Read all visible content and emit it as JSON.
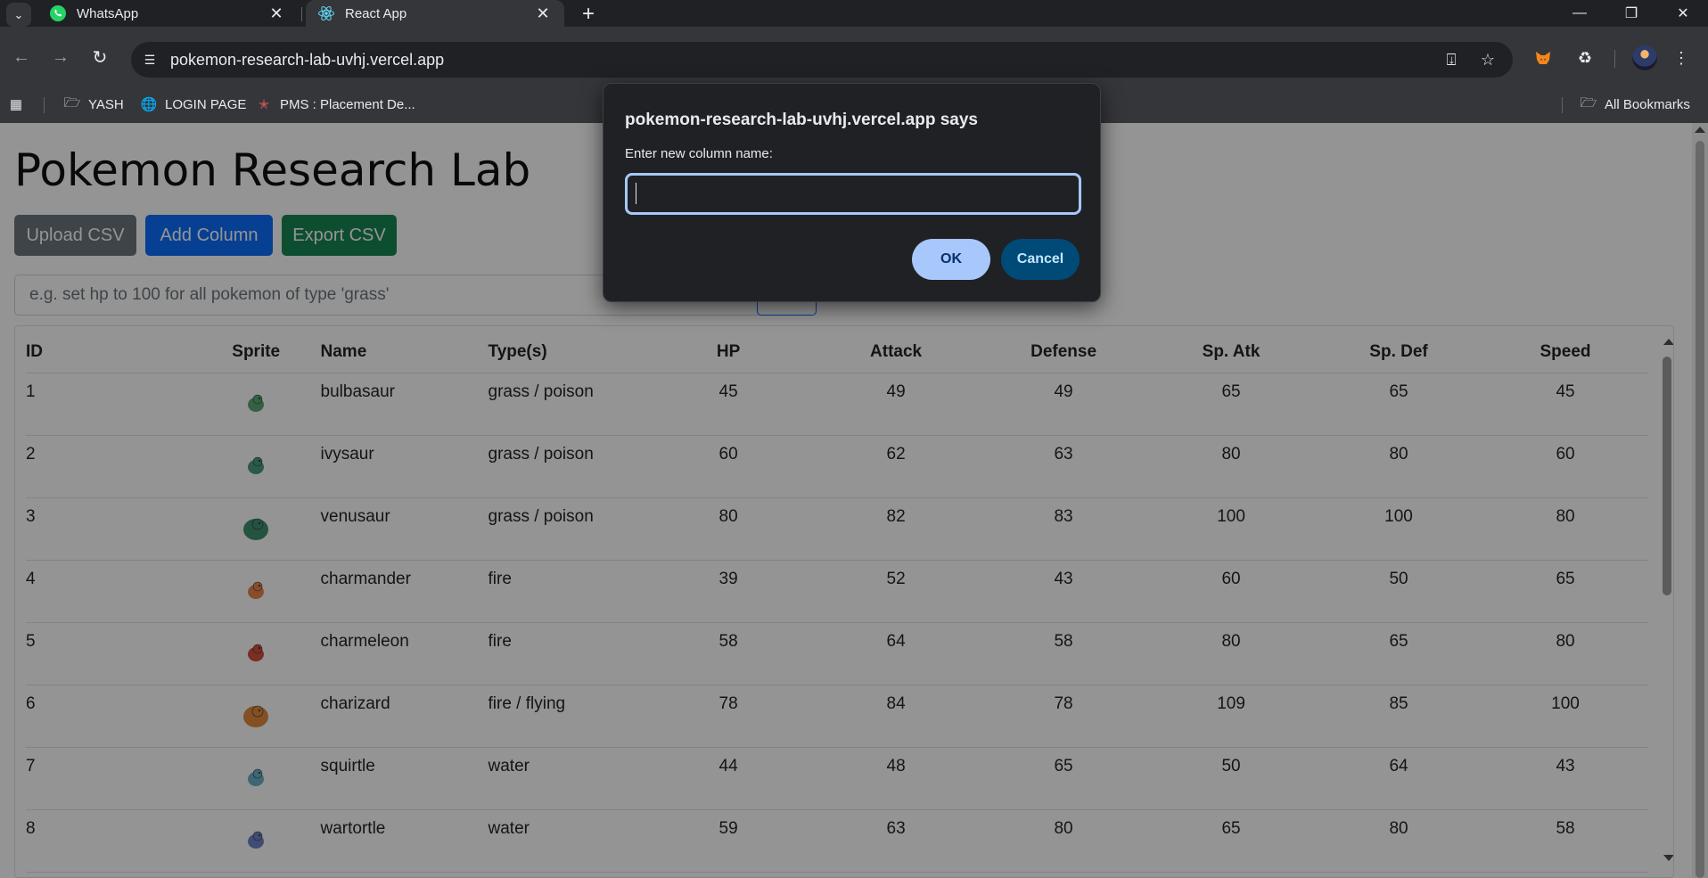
{
  "tabs": [
    {
      "title": "WhatsApp",
      "icon": "whatsapp-icon",
      "active": false
    },
    {
      "title": "React App",
      "icon": "react-icon",
      "active": true
    }
  ],
  "address_bar": {
    "url": "pokemon-research-lab-uvhj.vercel.app"
  },
  "bookmarks": [
    {
      "label": "YASH",
      "icon": "folder-icon"
    },
    {
      "label": "LOGIN PAGE",
      "icon": "globe-icon"
    },
    {
      "label": "PMS : Placement De...",
      "icon": "pms-logo-icon"
    },
    {
      "label": "All Bookmarks",
      "icon": "folder-icon"
    }
  ],
  "page": {
    "title": "Pokemon Research Lab",
    "buttons": {
      "upload": "Upload CSV",
      "add_column": "Add Column",
      "export": "Export CSV"
    },
    "command_placeholder": "e.g. set hp to 100 for all pokemon of type 'grass'",
    "table": {
      "headers": [
        "ID",
        "Sprite",
        "Name",
        "Type(s)",
        "HP",
        "Attack",
        "Defense",
        "Sp. Atk",
        "Sp. Def",
        "Speed"
      ],
      "rows": [
        {
          "id": "1",
          "name": "bulbasaur",
          "types": "grass / poison",
          "hp": "45",
          "attack": "49",
          "defense": "49",
          "sp_atk": "65",
          "sp_def": "65",
          "speed": "45",
          "sprite_color": "#5aa876"
        },
        {
          "id": "2",
          "name": "ivysaur",
          "types": "grass / poison",
          "hp": "60",
          "attack": "62",
          "defense": "63",
          "sp_atk": "80",
          "sp_def": "80",
          "speed": "60",
          "sprite_color": "#4b9a83"
        },
        {
          "id": "3",
          "name": "venusaur",
          "types": "grass / poison",
          "hp": "80",
          "attack": "82",
          "defense": "83",
          "sp_atk": "100",
          "sp_def": "100",
          "speed": "80",
          "sprite_color": "#3f8f6e"
        },
        {
          "id": "4",
          "name": "charmander",
          "types": "fire",
          "hp": "39",
          "attack": "52",
          "defense": "43",
          "sp_atk": "60",
          "sp_def": "50",
          "speed": "65",
          "sprite_color": "#e8874a"
        },
        {
          "id": "5",
          "name": "charmeleon",
          "types": "fire",
          "hp": "58",
          "attack": "64",
          "defense": "58",
          "sp_atk": "80",
          "sp_def": "65",
          "speed": "80",
          "sprite_color": "#d4503a"
        },
        {
          "id": "6",
          "name": "charizard",
          "types": "fire / flying",
          "hp": "78",
          "attack": "84",
          "defense": "78",
          "sp_atk": "109",
          "sp_def": "85",
          "speed": "100",
          "sprite_color": "#e08a3c"
        },
        {
          "id": "7",
          "name": "squirtle",
          "types": "water",
          "hp": "44",
          "attack": "48",
          "defense": "65",
          "sp_atk": "50",
          "sp_def": "64",
          "speed": "43",
          "sprite_color": "#6cb0c8"
        },
        {
          "id": "8",
          "name": "wartortle",
          "types": "water",
          "hp": "59",
          "attack": "63",
          "defense": "80",
          "sp_atk": "65",
          "sp_def": "80",
          "speed": "58",
          "sprite_color": "#6f84c9"
        }
      ]
    }
  },
  "dialog": {
    "title": "pokemon-research-lab-uvhj.vercel.app says",
    "message": "Enter new column name:",
    "input_value": "",
    "ok": "OK",
    "cancel": "Cancel"
  }
}
